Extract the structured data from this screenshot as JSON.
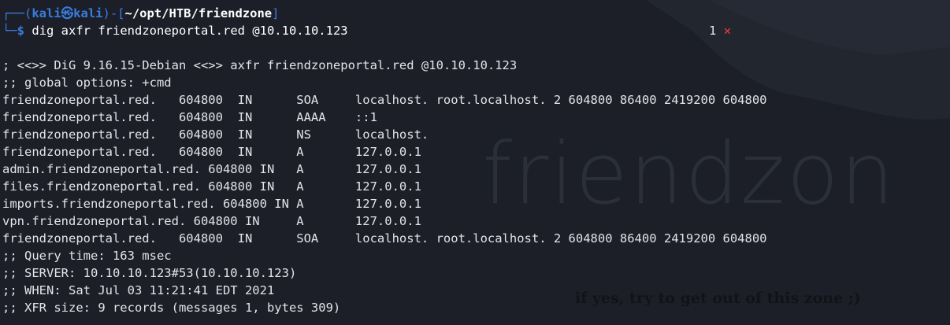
{
  "prompt": {
    "box_top": "┌──(",
    "user": "kali",
    "at_symbol": "㉿",
    "host": "kali",
    "close_paren": ")-[",
    "path": "~/opt/HTB/friendzone",
    "close_bracket": "]",
    "box_bottom": "└─",
    "dollar": "$",
    "command": "dig axfr friendzoneportal.red @10.10.10.123"
  },
  "status": {
    "exit_code": "1",
    "error_icon": "x-mark-icon",
    "error_glyph": "✕"
  },
  "output": [
    "; <<>> DiG 9.16.15-Debian <<>> axfr friendzoneportal.red @10.10.10.123",
    ";; global options: +cmd",
    "friendzoneportal.red.   604800  IN      SOA     localhost. root.localhost. 2 604800 86400 2419200 604800",
    "friendzoneportal.red.   604800  IN      AAAA    ::1",
    "friendzoneportal.red.   604800  IN      NS      localhost.",
    "friendzoneportal.red.   604800  IN      A       127.0.0.1",
    "admin.friendzoneportal.red. 604800 IN   A       127.0.0.1",
    "files.friendzoneportal.red. 604800 IN   A       127.0.0.1",
    "imports.friendzoneportal.red. 604800 IN A       127.0.0.1",
    "vpn.friendzoneportal.red. 604800 IN     A       127.0.0.1",
    "friendzoneportal.red.   604800  IN      SOA     localhost. root.localhost. 2 604800 86400 2419200 604800",
    ";; Query time: 163 msec",
    ";; SERVER: 10.10.10.123#53(10.10.10.123)",
    ";; WHEN: Sat Jul 03 11:21:41 EDT 2021",
    ";; XFR size: 9 records (messages 1, bytes 309)"
  ],
  "wallpaper": {
    "word": "friendzon",
    "motto": "if yes, try to get out of this zone ;)"
  },
  "colors": {
    "background": "#1c1f28",
    "prompt_accent": "#3a7ce0",
    "error": "#ff3b3b",
    "text": "#e3e4e8"
  }
}
